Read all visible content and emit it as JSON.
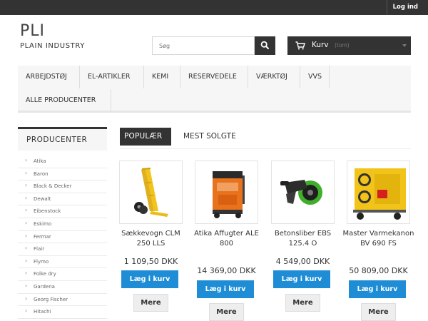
{
  "header": {
    "login_label": "Log ind",
    "logo_title": "PLI",
    "logo_subtitle": "PLAIN INDUSTRY",
    "search_placeholder": "Søg",
    "cart_label": "Kurv",
    "cart_status": "(tom)"
  },
  "nav": {
    "items": [
      "ARBEJDSTØJ",
      "EL-ARTIKLER",
      "KEMI",
      "RESERVEDELE",
      "VÆRKTØJ",
      "VVS",
      "ALLE PRODUCENTER"
    ]
  },
  "sidebar": {
    "title": "PRODUCENTER",
    "items": [
      "Atika",
      "Baron",
      "Black & Decker",
      "Dewalt",
      "Eibenstock",
      "Eskimo",
      "Fermar",
      "Flair",
      "Flymo",
      "Folke dry",
      "Gardena",
      "Georg Fischer",
      "Hitachi"
    ]
  },
  "tabs": {
    "active": "POPULÆR",
    "other": "MEST SOLGTE"
  },
  "products": [
    {
      "name": "Sækkevogn CLM 250 LLS",
      "price": "1 109,50 DKK",
      "add_label": "Læg i kurv",
      "more_label": "Mere"
    },
    {
      "name": "Atika Affugter ALE 800",
      "price": "14 369,00 DKK",
      "add_label": "Læg i kurv",
      "more_label": "Mere"
    },
    {
      "name": "Betonsliber EBS 125.4 O",
      "price": "4 549,00 DKK",
      "add_label": "Læg i kurv",
      "more_label": "Mere"
    },
    {
      "name": "Master Varmekanon BV 690 FS",
      "price": "50 809,00 DKK",
      "add_label": "Læg i kurv",
      "more_label": "Mere"
    }
  ],
  "colors": {
    "dark": "#333333",
    "accent_blue": "#1f8dd6",
    "heater_yellow": "#f2c318",
    "dehumidifier_orange": "#e8731c"
  }
}
